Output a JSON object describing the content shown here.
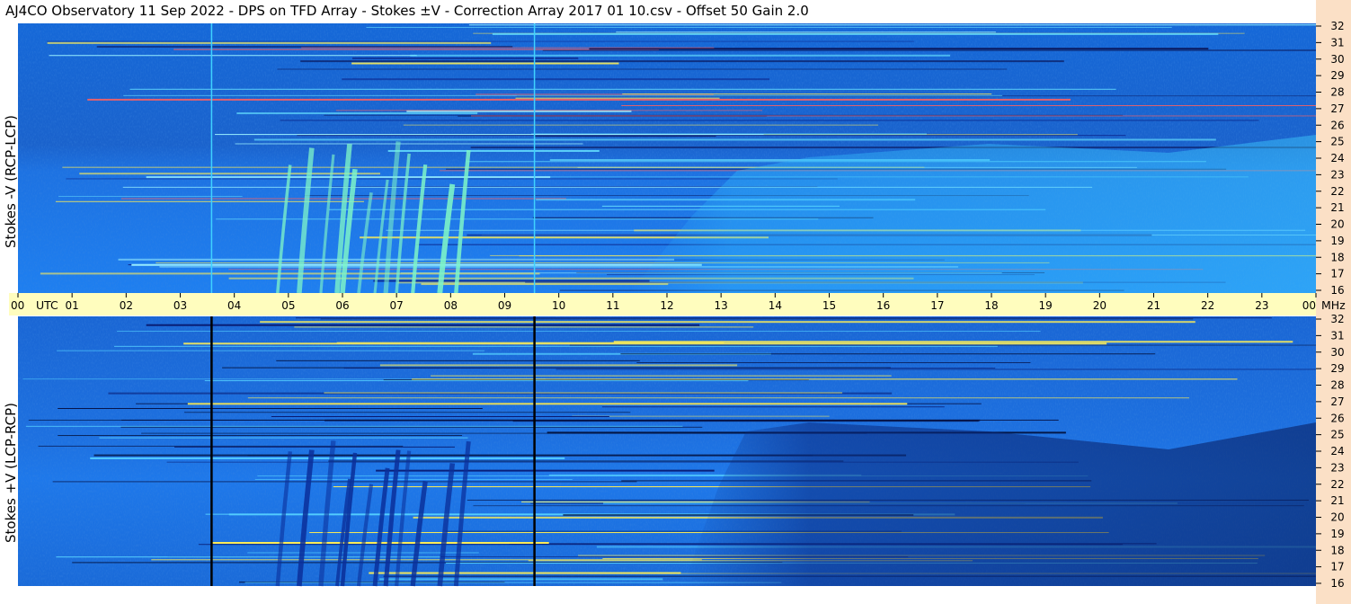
{
  "title": "AJ4CO Observatory  11 Sep 2022  -  DPS on TFD Array  -  Stokes ±V  -  Correction Array 2017 01 10.csv  -  Offset 50  Gain 2.0",
  "panels": [
    {
      "ylabel": "Stokes -V (RCP-LCP)"
    },
    {
      "ylabel": "Stokes +V (LCP-RCP)"
    }
  ],
  "colors": {
    "background_blue": "#1a73e6",
    "band_yellow": "#fffdbe",
    "strip_peach": "#fbe0c6"
  },
  "chart_data": {
    "type": "heatmap",
    "x_axis": {
      "unit_label": "UTC",
      "ticks": [
        "00",
        "01",
        "02",
        "03",
        "04",
        "05",
        "06",
        "07",
        "08",
        "09",
        "10",
        "11",
        "12",
        "13",
        "14",
        "15",
        "16",
        "17",
        "18",
        "19",
        "20",
        "21",
        "22",
        "23",
        "00"
      ],
      "end_unit": "MHz",
      "range_hours": [
        0,
        24
      ]
    },
    "y_axis": {
      "unit": "MHz",
      "range": [
        16,
        32
      ],
      "ticks": [
        "32",
        "31",
        "30",
        "29",
        "28",
        "27",
        "26",
        "25",
        "24",
        "23",
        "22",
        "21",
        "20",
        "19",
        "18",
        "17",
        "16"
      ]
    },
    "vertical_lines_hours": [
      3.58,
      9.55
    ],
    "bursts_hours": [
      4.8,
      5.2,
      5.6,
      5.9,
      6.0,
      6.3,
      6.6,
      6.8,
      7.0,
      7.3,
      7.8,
      8.1
    ]
  }
}
